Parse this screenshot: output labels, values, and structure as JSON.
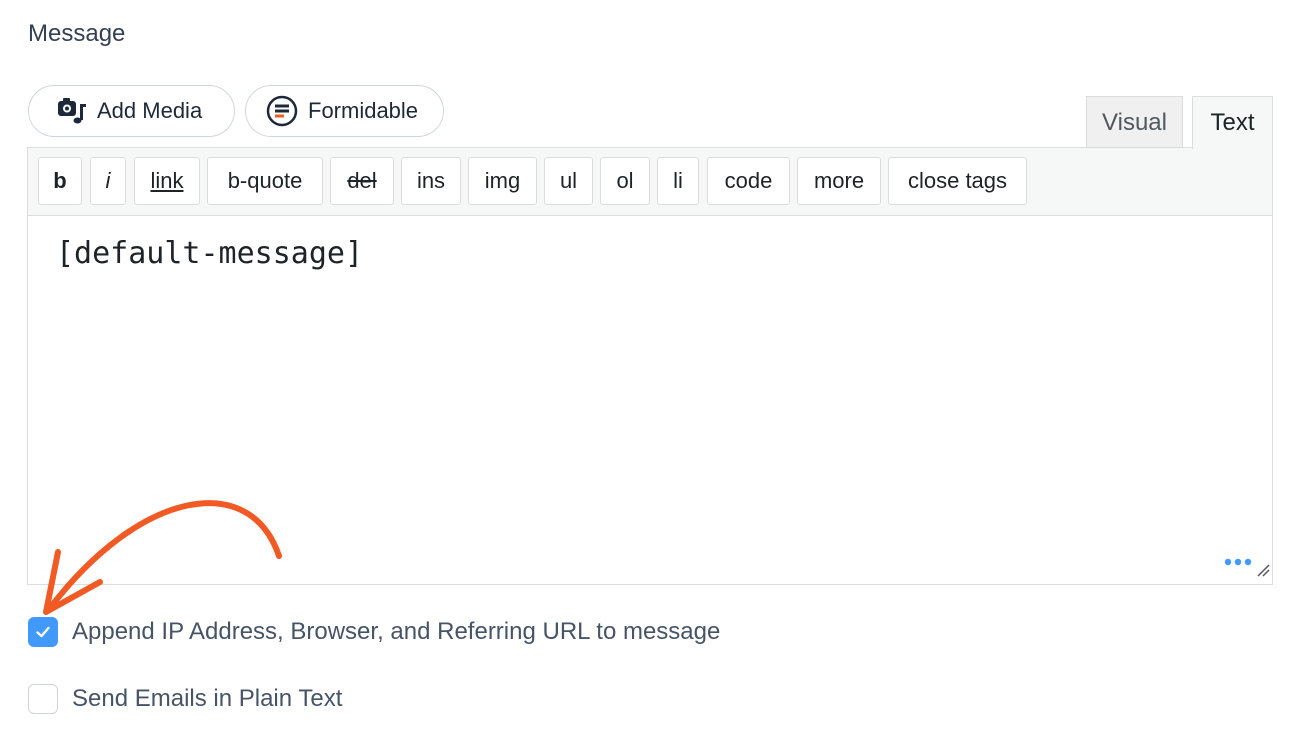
{
  "section": {
    "label": "Message"
  },
  "media_buttons": {
    "add_media": "Add Media",
    "formidable": "Formidable"
  },
  "tabs": {
    "visual": "Visual",
    "text": "Text",
    "active": "Text"
  },
  "toolbar": {
    "buttons": [
      "b",
      "i",
      "link",
      "b-quote",
      "del",
      "ins",
      "img",
      "ul",
      "ol",
      "li",
      "code",
      "more",
      "close tags"
    ]
  },
  "editor": {
    "content": "[default-message]"
  },
  "options": {
    "append_info": {
      "label": "Append IP Address, Browser, and Referring URL to message",
      "checked": true
    },
    "plain_text": {
      "label": "Send Emails in Plain Text",
      "checked": false
    }
  },
  "colors": {
    "accent": "#4199fd",
    "annotation_arrow": "#f15a24"
  }
}
